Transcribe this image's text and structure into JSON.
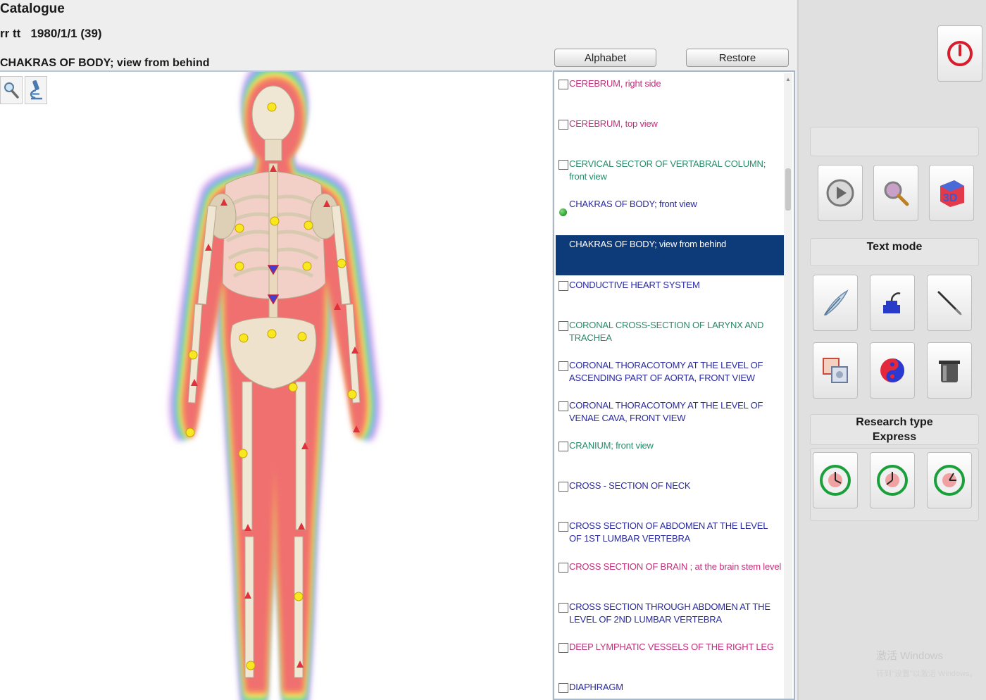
{
  "header": {
    "title": "Catalogue",
    "patient_name": "rr tt",
    "patient_info": "1980/1/1 (39)",
    "view_title": "CHAKRAS OF BODY; view from behind",
    "alphabet_label": "Alphabet",
    "restore_label": "Restore"
  },
  "toolbar": {
    "zoom_icon": "magnifier-icon",
    "microscope_icon": "microscope-icon"
  },
  "list": {
    "items": [
      {
        "label": "CEREBRUM, right side",
        "color": "#c0307a",
        "checked": false
      },
      {
        "label": "CEREBRUM, top view",
        "color": "#c0307a",
        "checked": false
      },
      {
        "label": "CERVICAL SECTOR OF VERTABRAL COLUMN; front view",
        "color": "#2a8a6a",
        "checked": false
      },
      {
        "label": "CHAKRAS OF BODY; front view",
        "color": "#2a2aa0",
        "checked": false,
        "status": "green-dot"
      },
      {
        "label": "CHAKRAS OF BODY; view from behind",
        "color": "#ffffff",
        "selected": true
      },
      {
        "label": "CONDUCTIVE HEART SYSTEM",
        "color": "#2a2aa0",
        "checked": false
      },
      {
        "label": "CORONAL CROSS-SECTION OF LARYNX AND TRACHEA",
        "color": "#2a8a6a",
        "checked": false
      },
      {
        "label": "CORONAL THORACOTOMY AT THE LEVEL OF ASCENDING PART OF AORTA, FRONT VIEW",
        "color": "#2a2aa0",
        "checked": false
      },
      {
        "label": "CORONAL THORACOTOMY AT THE LEVEL OF VENAE CAVA, FRONT VIEW",
        "color": "#2a2aa0",
        "checked": false
      },
      {
        "label": "CRANIUM; front view",
        "color": "#2a8a6a",
        "checked": false
      },
      {
        "label": "CROSS - SECTION OF NECK",
        "color": "#2a2aa0",
        "checked": false
      },
      {
        "label": "CROSS SECTION OF ABDOMEN AT THE LEVEL OF 1ST LUMBAR VERTEBRA",
        "color": "#2a2aa0",
        "checked": false
      },
      {
        "label": "CROSS SECTION OF BRAIN ; at the brain stem level",
        "color": "#c0307a",
        "checked": false
      },
      {
        "label": "CROSS SECTION THROUGH ABDOMEN AT THE LEVEL OF 2ND LUMBAR VERTEBRA",
        "color": "#2a2aa0",
        "checked": false
      },
      {
        "label": "DEEP LYMPHATIC VESSELS OF THE RIGHT LEG",
        "color": "#c0307a",
        "checked": false
      },
      {
        "label": "DIAPHRAGM",
        "color": "#2a2aa0",
        "checked": false
      }
    ]
  },
  "right_panel": {
    "text_mode_label": "Text mode",
    "research_type_label": "Research type",
    "research_mode_label": "Express",
    "watermark_line1": "激活 Windows",
    "watermark_line2": "转到\"设置\"以激活 Windows。",
    "icons": {
      "power": "power-icon",
      "play": "play-icon",
      "search": "magnifier-icon",
      "cube_3d": "cube-3d-icon",
      "quill": "quill-icon",
      "inkwell": "inkwell-icon",
      "pen": "pen-icon",
      "images": "images-icon",
      "yin_yang": "yin-yang-icon",
      "pot": "pot-icon",
      "clock1": "clock-icon",
      "clock2": "clock-icon",
      "clock3": "clock-icon"
    }
  },
  "colors": {
    "selection": "#0d3a78",
    "green_status": "#1a8a1a",
    "power_red": "#d81c2a"
  }
}
